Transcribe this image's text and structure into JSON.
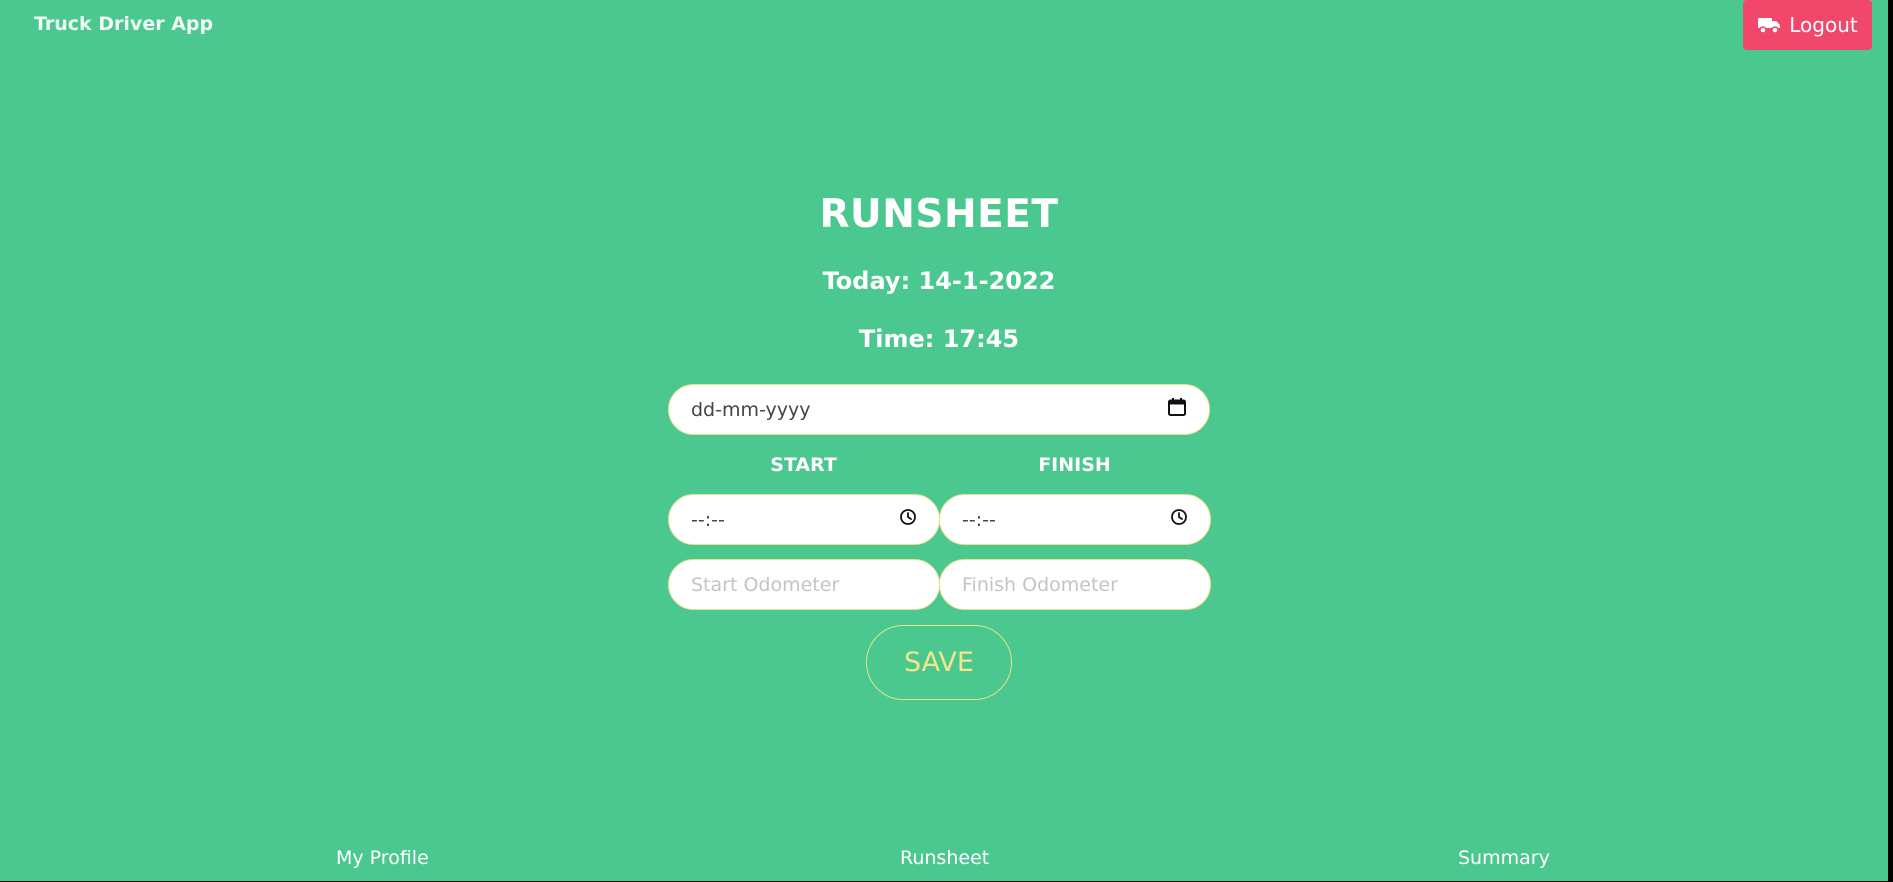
{
  "app": {
    "brand": "Truck Driver App"
  },
  "header": {
    "logout_label": "Logout",
    "logout_icon": "truck-icon",
    "logout_color": "#f0476b"
  },
  "main": {
    "title": "RUNSHEET",
    "today": "Today: 14-1-2022",
    "time": "Time: 17:45",
    "date_input": {
      "value": "dd-mm-yyyy",
      "icon": "calendar-icon"
    },
    "start_label": "START",
    "finish_label": "FINISH",
    "start_time": {
      "value": "--:--",
      "icon": "clock-icon"
    },
    "finish_time": {
      "value": "--:--",
      "icon": "clock-icon"
    },
    "start_odometer": {
      "placeholder": "Start Odometer"
    },
    "finish_odometer": {
      "placeholder": "Finish Odometer"
    },
    "save_label": "SAVE"
  },
  "footer_nav": {
    "items": [
      {
        "label": "My Profile"
      },
      {
        "label": "Runsheet"
      },
      {
        "label": "Summary"
      }
    ]
  },
  "colors": {
    "background": "#4ac88f",
    "accent": "#f4e687"
  }
}
